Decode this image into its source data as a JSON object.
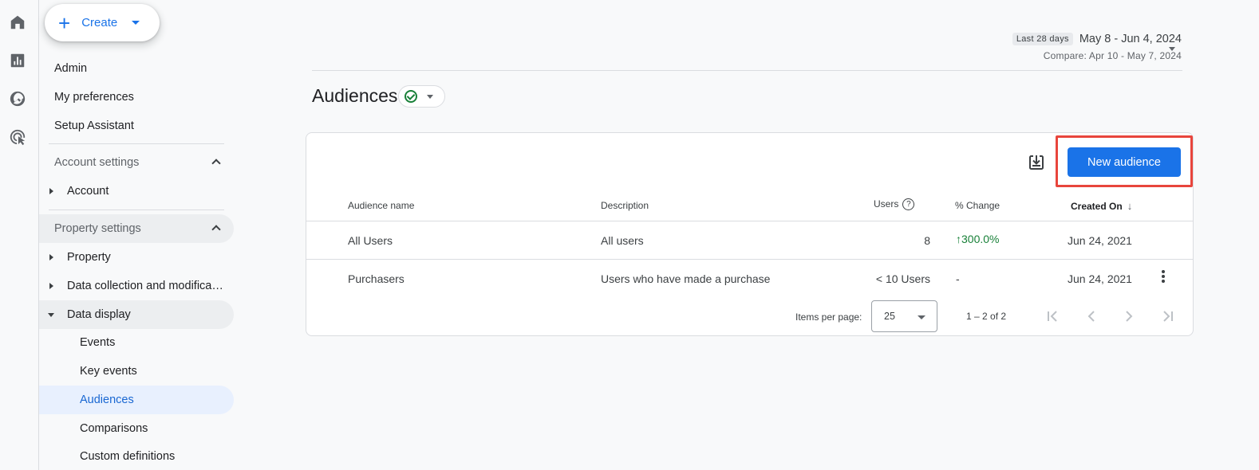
{
  "rail": {
    "icons": [
      "home-icon",
      "reports-icon",
      "explore-icon",
      "advertising-icon"
    ]
  },
  "sidebar": {
    "create_label": "Create",
    "items": {
      "admin": "Admin",
      "my_preferences": "My preferences",
      "setup_assistant": "Setup Assistant",
      "account_settings": "Account settings",
      "account": "Account",
      "property_settings": "Property settings",
      "property": "Property",
      "data_collection": "Data collection and modifica…",
      "data_display": "Data display",
      "events": "Events",
      "key_events": "Key events",
      "audiences": "Audiences",
      "comparisons": "Comparisons",
      "custom_definitions": "Custom definitions"
    }
  },
  "header": {
    "date_chip": "Last 28 days",
    "date_range": "May 8 - Jun 4, 2024",
    "compare": "Compare: Apr 10 - May 7, 2024"
  },
  "page": {
    "title": "Audiences"
  },
  "toolbar": {
    "new_audience_label": "New audience"
  },
  "table": {
    "columns": {
      "name": "Audience name",
      "description": "Description",
      "users": "Users",
      "change": "% Change",
      "created": "Created On"
    },
    "rows": [
      {
        "name": "All Users",
        "description": "All users",
        "users": "8",
        "change": "300.0%",
        "change_arrow": "↑",
        "created": "Jun 24, 2021"
      },
      {
        "name": "Purchasers",
        "description": "Users who have made a purchase",
        "users": "< 10 Users",
        "change": "-",
        "created": "Jun 24, 2021"
      }
    ]
  },
  "pager": {
    "items_per_page_label": "Items per page:",
    "items_per_page_value": "25",
    "range": "1 – 2 of 2"
  },
  "colors": {
    "accent": "#1a73e8",
    "highlight": "#e8453c",
    "positive": "#188038"
  }
}
